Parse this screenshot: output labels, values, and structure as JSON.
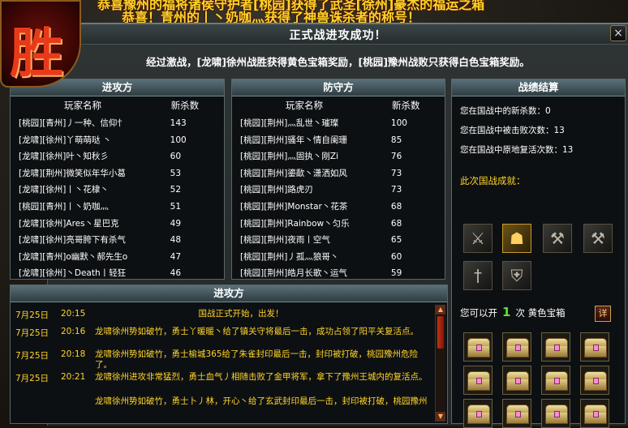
{
  "banner": {
    "line1": "恭喜豫州的福将诸侯守护者[桃园]获得了武圣[徐州]豪杰的福运之箱",
    "line2": "恭喜！青州的丨丶奶咖灬获得了神兽诛杀者的称号！"
  },
  "seal": {
    "glyph": "胜"
  },
  "dialog": {
    "title": "正式战进攻成功！",
    "close_label": "×",
    "summary": "经过激战，[龙啸]徐州战胜获得黄色宝箱奖励，[桃园]豫州战败只获得白色宝箱奖励。"
  },
  "attack": {
    "header": "进攻方",
    "col_name": "玩家名称",
    "col_kills": "新杀数",
    "rows": [
      {
        "name": "[桃园][青州]丿一种、信仰忄",
        "kills": "143"
      },
      {
        "name": "[龙啸][徐州]丫萌萌哒 丶",
        "kills": "100"
      },
      {
        "name": "[龙啸][徐州]叶丶知秋彡",
        "kills": "60"
      },
      {
        "name": "[龙啸][荆州]微笑似年华小葛",
        "kills": "53"
      },
      {
        "name": "[龙啸][徐州]丨丶花棣丶",
        "kills": "52"
      },
      {
        "name": "[桃园][青州]丨丶奶咖灬",
        "kills": "51"
      },
      {
        "name": "[龙啸][徐州]Ares丶星巴克",
        "kills": "49"
      },
      {
        "name": "[龙啸][徐州]亮哥胯下有杀气",
        "kills": "48"
      },
      {
        "name": "[龙啸][青州]o幽默丶郝先生o",
        "kills": "47"
      },
      {
        "name": "[龙啸][徐州]丶Death丨轻狂",
        "kills": "46"
      }
    ]
  },
  "defense": {
    "header": "防守方",
    "col_name": "玩家名称",
    "col_kills": "新杀数",
    "rows": [
      {
        "name": "[桃园][荆州]灬乱世丶璀璨",
        "kills": "100"
      },
      {
        "name": "[桃园][荆州]骚年丶情自阑珊",
        "kills": "85"
      },
      {
        "name": "[桃园][荆州]灬固执丶刚Zi",
        "kills": "76"
      },
      {
        "name": "[桃园][荆州]鎏歃丶潇洒如风",
        "kills": "73"
      },
      {
        "name": "[桃园][荆州]路虎刃",
        "kills": "73"
      },
      {
        "name": "[桃园][荆州]Monstar丶花茶",
        "kills": "68"
      },
      {
        "name": "[桃园][荆州]Rainbow丶匀乐",
        "kills": "68"
      },
      {
        "name": "[桃园][荆州]夜雨丨空气",
        "kills": "65"
      },
      {
        "name": "[桃园][荆州]丿孤灬狼哥丶",
        "kills": "60"
      },
      {
        "name": "[桃园][荆州]皓月长歌丶运气",
        "kills": "59"
      }
    ]
  },
  "stats": {
    "header": "战绩结算",
    "kills": "您在国战中的新杀数：0",
    "defeated": "您在国战中被击败次数：13",
    "revives": "您在国战中原地复活次数：13",
    "achievements_title": "此次国战成就：",
    "badges": [
      {
        "icon": "crossed-swords-icon",
        "glyph": "⚔",
        "earned": false
      },
      {
        "icon": "warrior-icon",
        "glyph": "☗",
        "earned": true
      },
      {
        "icon": "axe-icon",
        "glyph": "⚒",
        "earned": false
      },
      {
        "icon": "hammer-icon",
        "glyph": "⚒",
        "earned": false
      },
      {
        "icon": "sword-icon",
        "glyph": "†",
        "earned": false
      },
      {
        "icon": "shield-icon",
        "glyph": "⛨",
        "earned": false
      }
    ],
    "open_prefix": "您可以开",
    "open_count": "1",
    "open_suffix": "次 黄色宝箱",
    "detail_label": "详",
    "chest_count": 12
  },
  "log": {
    "header": "进攻方",
    "entries": [
      {
        "date": "7月25日",
        "time": "20:15",
        "msg": "国战正式开始，出发！",
        "center": true
      },
      {
        "date": "7月25日",
        "time": "20:16",
        "msg": "龙啸徐州势如破竹，勇士丫暖暖丶给了镇关守将最后一击，成功占领了阳平关复活点。"
      },
      {
        "date": "7月25日",
        "time": "20:18",
        "msg": "龙啸徐州势如破竹，勇士榆城365给了朱雀封印最后一击，封印被打破，桃园豫州危险了。"
      },
      {
        "date": "7月25日",
        "time": "20:21",
        "msg": "龙啸徐州进攻非常猛烈，勇士血气丿相随击败了金甲将军，拿下了豫州王城内的复活点。"
      },
      {
        "date": "",
        "time": "",
        "msg": "龙啸徐州势如破竹，勇士卜丿林，开心丶给了玄武封印最后一击，封印被打破，桃园豫州"
      }
    ]
  }
}
